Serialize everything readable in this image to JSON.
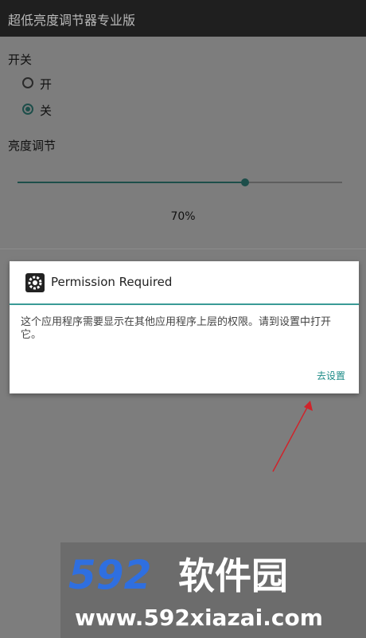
{
  "window": {
    "title": "超低亮度调节器专业版"
  },
  "switch": {
    "label": "开关",
    "options": [
      {
        "text": "开",
        "checked": false
      },
      {
        "text": "关",
        "checked": true
      }
    ]
  },
  "brightness": {
    "label": "亮度调节",
    "value": 0.7,
    "value_text": "70%"
  },
  "dialog": {
    "title": "Permission Required",
    "message": "这个应用程序需要显示在其他应用程序上层的权限。请到设置中打开它。",
    "button_label": "去设置",
    "icon": "gear-icon"
  },
  "watermark": {
    "brand": "592软件园",
    "url": "www.592xiazai.com"
  },
  "colors": {
    "accent": "#1d4e4a",
    "dialog_accent": "#3a9b96",
    "button": "#1c8b87",
    "arrow": "#d0232a"
  }
}
